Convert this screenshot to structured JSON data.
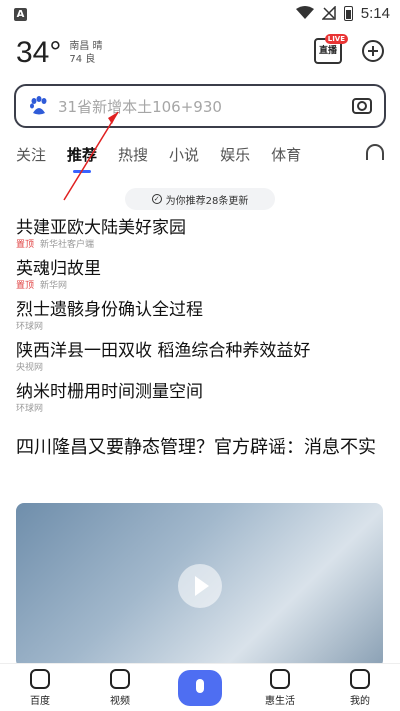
{
  "statusbar": {
    "time": "5:14"
  },
  "header": {
    "temperature": "34°",
    "city_weather": "南昌 晴",
    "aqi": "74 良",
    "live_label": "直播",
    "live_badge": "LIVE"
  },
  "search": {
    "placeholder": "31省新增本土106+930"
  },
  "tabs": [
    "关注",
    "推荐",
    "热搜",
    "小说",
    "娱乐",
    "体育"
  ],
  "active_tab": "推荐",
  "refresh_notice": "为你推荐28条更新",
  "news": [
    {
      "title": "共建亚欧大陆美好家园",
      "tag": "置顶",
      "source": "新华社客户端"
    },
    {
      "title": "英魂归故里",
      "tag": "置顶",
      "source": "新华网"
    },
    {
      "title": "烈士遗骸身份确认全过程",
      "tag": "",
      "source": "环球网"
    },
    {
      "title": "陕西洋县一田双收 稻渔综合种养效益好",
      "tag": "",
      "source": "央视网"
    },
    {
      "title": "纳米时栅用时间测量空间",
      "tag": "",
      "source": "环球网"
    }
  ],
  "feature": {
    "title": "四川隆昌又要静态管理？官方辟谣：消息不实"
  },
  "bottom_nav": [
    "百度",
    "视频",
    "",
    "惠生活",
    "我的"
  ],
  "colors": {
    "accent": "#4e6ef2",
    "tab_underline": "#3863ff",
    "top_tag": "#e04040",
    "annotation_arrow": "#e02020"
  }
}
